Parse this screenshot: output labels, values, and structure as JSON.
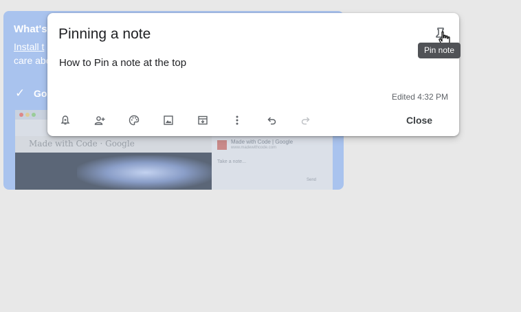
{
  "background_card": {
    "title": "What's",
    "link": "Install t",
    "body": "care abo",
    "check_text": "Go",
    "screenshot": {
      "made_with": "Made with Code · Google",
      "panel_title": "Made with Code | Google",
      "panel_url": "www.madewithcode.com",
      "take_note": "Take a note...",
      "send": "Send"
    }
  },
  "note": {
    "title": "Pinning a note",
    "body": "How to Pin a note at the top",
    "edited": "Edited 4:32 PM",
    "close_label": "Close"
  },
  "tooltip": {
    "text": "Pin note"
  },
  "toolbar": {
    "icons": [
      "remind-me-icon",
      "collaborator-icon",
      "palette-icon",
      "image-icon",
      "archive-icon",
      "more-icon",
      "undo-icon",
      "redo-icon"
    ]
  }
}
